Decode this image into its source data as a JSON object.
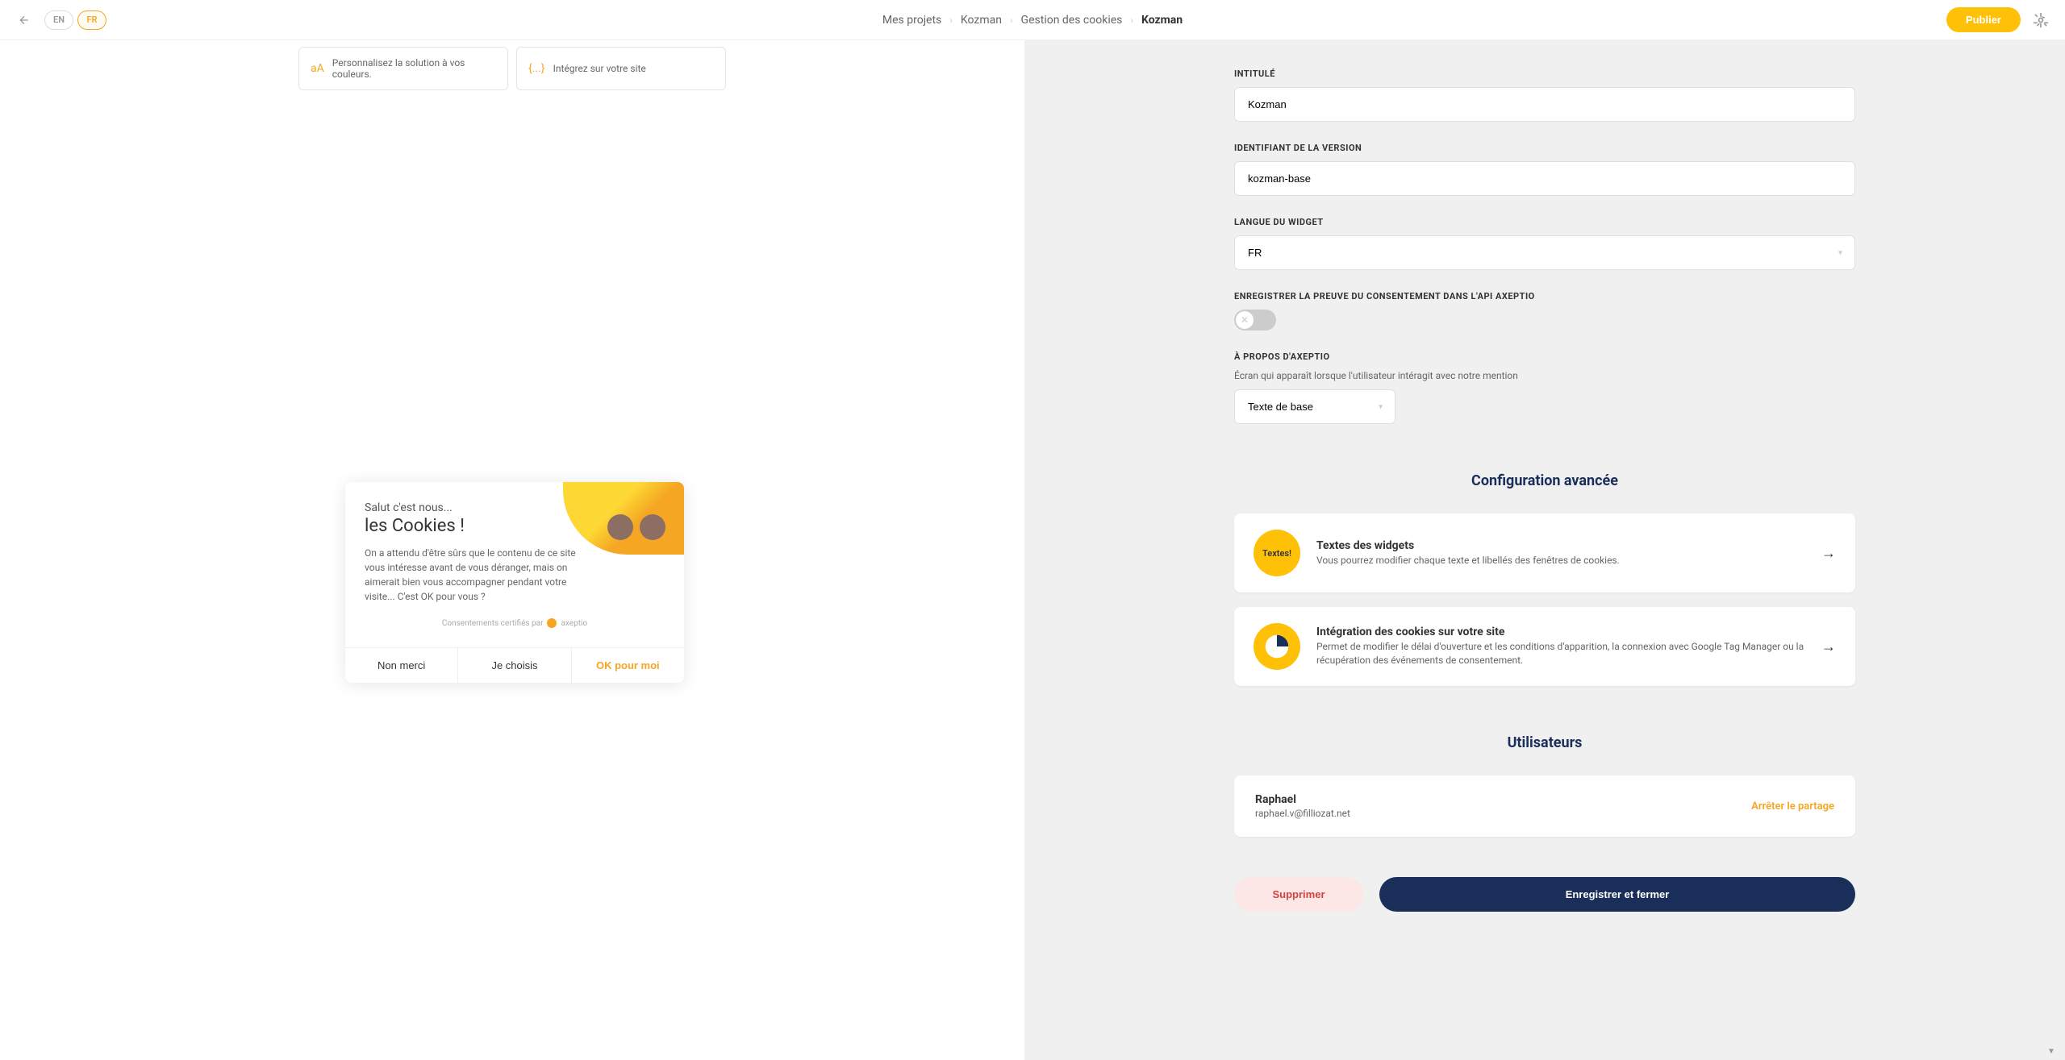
{
  "header": {
    "lang_en": "EN",
    "lang_fr": "FR",
    "breadcrumb": [
      "Mes projets",
      "Kozman",
      "Gestion des cookies",
      "Kozman"
    ],
    "publish": "Publier"
  },
  "left": {
    "card1": "Personnalisez la solution à vos couleurs.",
    "card1_icon": "aA",
    "card2": "Intégrez sur votre site",
    "card2_icon": "{...}",
    "cookie": {
      "title_small": "Salut c'est nous...",
      "title_big": "les Cookies !",
      "desc": "On a attendu d'être sûrs que le contenu de ce site vous intéresse avant de vous déranger, mais on aimerait bien vous accompagner pendant votre visite...\nC'est OK pour vous ?",
      "cert": "Consentements certifiés par",
      "cert_brand": "axeptio",
      "btn_no": "Non merci",
      "btn_choose": "Je choisis",
      "btn_ok": "OK pour moi"
    }
  },
  "form": {
    "label_title": "INTITULÉ",
    "value_title": "Kozman",
    "label_id": "IDENTIFIANT DE LA VERSION",
    "value_id": "kozman-base",
    "label_lang": "LANGUE DU WIDGET",
    "value_lang": "FR",
    "label_api": "ENREGISTRER LA PREUVE DU CONSENTEMENT DANS L'API AXEPTIO",
    "label_about": "À PROPOS D'AXEPTIO",
    "desc_about": "Écran qui apparaît lorsque l'utilisateur intéragit avec notre mention",
    "value_about": "Texte de base"
  },
  "advanced": {
    "section_title": "Configuration avancée",
    "card1_icon": "Textes!",
    "card1_title": "Textes des widgets",
    "card1_desc": "Vous pourrez modifier chaque texte et libellés des fenêtres de cookies.",
    "card2_title": "Intégration des cookies sur votre site",
    "card2_desc": "Permet de modifier le délai d'ouverture et les conditions d'apparition, la connexion avec Google Tag Manager ou la récupération des événements de consentement."
  },
  "users": {
    "section_title": "Utilisateurs",
    "name": "Raphael",
    "email": "raphael.v@filliozat.net",
    "stop": "Arrêter le partage"
  },
  "footer": {
    "delete": "Supprimer",
    "save": "Enregistrer et fermer"
  }
}
